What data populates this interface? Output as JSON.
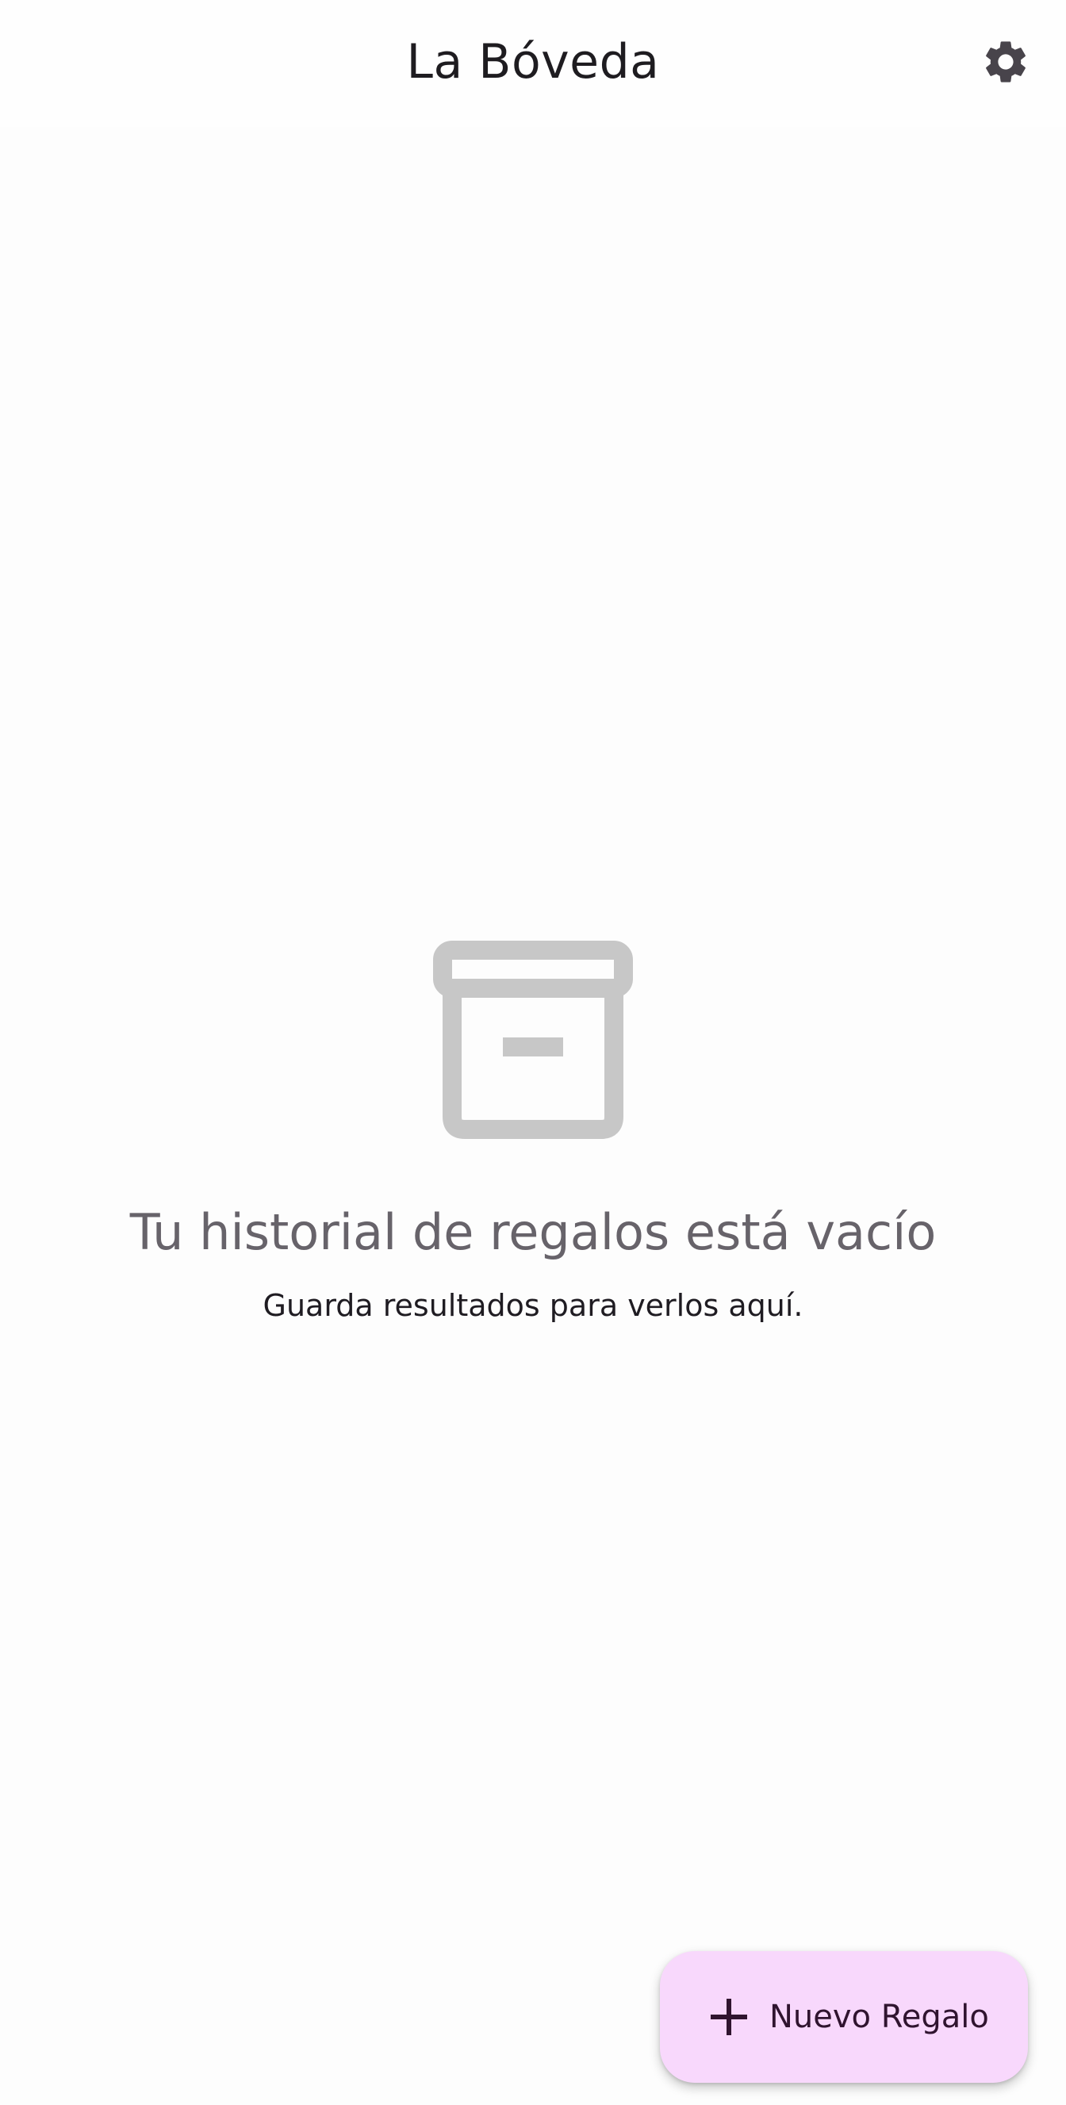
{
  "app_bar": {
    "title": "La Bóveda",
    "settings_icon": "gear-icon"
  },
  "empty_state": {
    "icon": "archive-box-icon",
    "title": "Tu historial de regalos está vacío",
    "subtitle": "Guarda resultados para verlos aquí."
  },
  "fab": {
    "icon": "plus-icon",
    "label": "Nuevo Regalo"
  },
  "colors": {
    "background": "#fdfdfd",
    "fab_background": "#f8d8fc",
    "icon_gray": "#c7c7c7",
    "title_gray": "#67636a",
    "text_dark": "#1f1c22"
  }
}
